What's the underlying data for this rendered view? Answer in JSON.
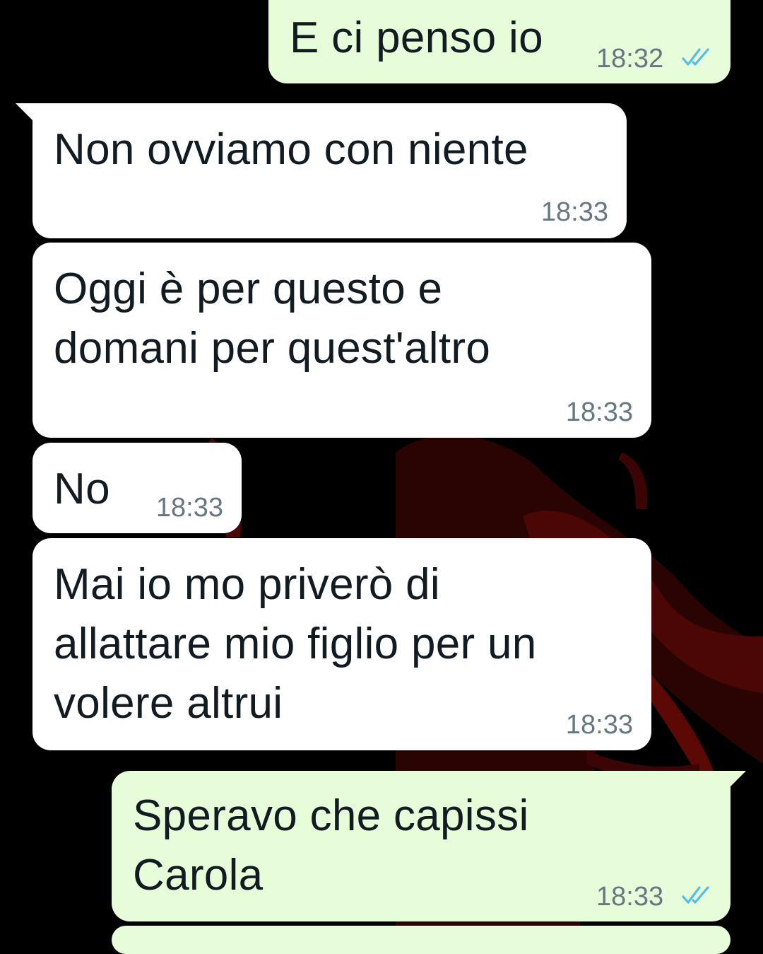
{
  "colors": {
    "background": "#000000",
    "incoming_bubble": "#ffffff",
    "outgoing_bubble": "#e7fcd9",
    "message_text": "#111b21",
    "timestamp_text": "#667781",
    "read_ticks": "#53bdeb",
    "wallpaper_accent": "#7a0a08"
  },
  "icons": {
    "read_receipt": "double-check-icon"
  },
  "messages": [
    {
      "direction": "outgoing",
      "text": "E ci penso io",
      "time": "18:32",
      "status": "read"
    },
    {
      "direction": "incoming",
      "text": "Non ovviamo con niente",
      "time": "18:33"
    },
    {
      "direction": "incoming",
      "text": "Oggi è per questo e\ndomani per quest'altro",
      "time": "18:33"
    },
    {
      "direction": "incoming",
      "text": "No",
      "time": "18:33"
    },
    {
      "direction": "incoming",
      "text": "Mai io mo priverò di\nallattare mio figlio per un\nvolere altrui",
      "time": "18:33"
    },
    {
      "direction": "outgoing",
      "text": "Speravo che capissi\nCarola",
      "time": "18:33",
      "status": "read"
    }
  ]
}
